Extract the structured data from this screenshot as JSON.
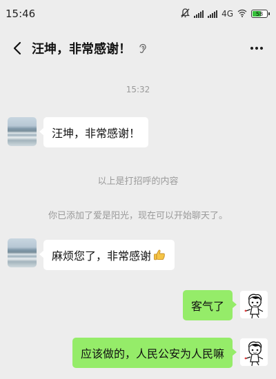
{
  "status_bar": {
    "time": "15:46",
    "network": "4G",
    "battery_text": "58"
  },
  "header": {
    "title": "汪坤，非常感谢！"
  },
  "chat": {
    "timestamp": "15:32",
    "system_messages": [
      "以上是打招呼的内容",
      "你已添加了爱是阳光，现在可以开始聊天了。"
    ],
    "messages": [
      {
        "side": "left",
        "text": "汪坤，非常感谢！"
      },
      {
        "side": "left",
        "text": "麻烦您了，非常感谢",
        "emoji": "thumbs-up-icon"
      },
      {
        "side": "right",
        "text": "客气了"
      },
      {
        "side": "right",
        "text": "应该做的，人民公安为人民嘛"
      }
    ]
  },
  "colors": {
    "background": "#ededed",
    "bubble_self": "#95ec69",
    "bubble_other": "#ffffff",
    "battery_fill": "#36c13a"
  }
}
